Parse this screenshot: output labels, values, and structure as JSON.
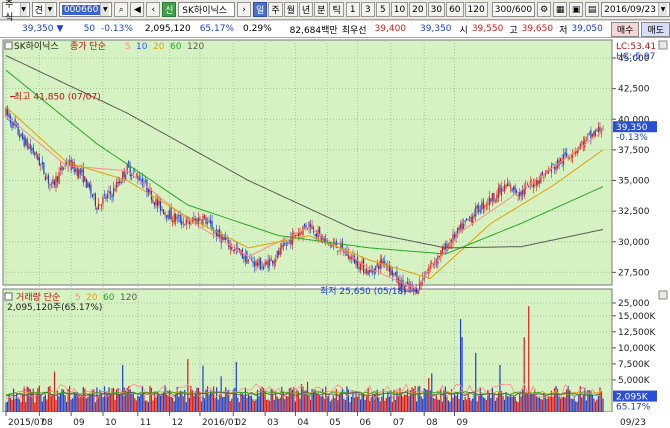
{
  "toolbar": {
    "market": "주식",
    "mode": "견",
    "code": "000660",
    "tag": "신",
    "stock_name": "SK하이닉스",
    "period_buttons": [
      "일",
      "주",
      "월",
      "년",
      "분",
      "틱"
    ],
    "active_period": "일",
    "interval_buttons": [
      "1",
      "3",
      "5",
      "10",
      "20",
      "30",
      "60",
      "120"
    ],
    "count": "300",
    "count_max": "/600",
    "date": "2016/09/23"
  },
  "quote": {
    "price": "39,350",
    "change": "50",
    "change_pct": "-0.13%",
    "volume": "2,095,120",
    "volume_ratio": "65.17%",
    "turnover": "0.29%",
    "amount": "82,684백만",
    "prefer_label": "최우선",
    "prefer_price": "39,400",
    "prefer_price2": "39,350",
    "open_label": "시",
    "open": "39,550",
    "high_label": "고",
    "high": "39,650",
    "low_label": "저",
    "low": "39,050",
    "buy_label": "매수",
    "sell_label": "매도"
  },
  "price_panel": {
    "stock_label": "SK하이닉스",
    "legend_prefix": "종가 단순",
    "ma_periods": [
      "5",
      "10",
      "20",
      "60",
      "120"
    ],
    "lc_label": "LC:53.41",
    "hc_label": "HC:-5.97",
    "max_annotation": "최고 41,850 (07/07)",
    "min_annotation": "최저 25,650 (05/18)",
    "current_tag": "39,350",
    "current_tag_pct": "-0.13%",
    "y_ticks": [
      "45,000",
      "42,500",
      "40,000",
      "37,500",
      "35,000",
      "32,500",
      "30,000",
      "27,500",
      "25,000"
    ]
  },
  "volume_panel": {
    "legend_prefix": "거래량 단순",
    "ma_periods": [
      "5",
      "20",
      "60",
      "120"
    ],
    "volume_text": "2,095,120주(65.17%)",
    "current_tag": "2,095K",
    "current_tag_pct": "65.17%",
    "y_ticks": [
      "15,000K",
      "12,500K",
      "10,000K",
      "7,500K",
      "5,000K"
    ]
  },
  "x_axis": {
    "ticks": [
      "2015/07",
      "08",
      "09",
      "10",
      "11",
      "12",
      "2016/01",
      "02",
      "03",
      "04",
      "05",
      "06",
      "07",
      "08",
      "09",
      "09/23"
    ]
  },
  "colors": {
    "chart_bg": "#d7f2c2",
    "up": "#e01818",
    "down": "#1f3fd0",
    "ma5": "#ff8a8a",
    "ma10": "#3355ff",
    "ma20": "#e0a000",
    "ma60": "#27a927",
    "ma120": "#5a5a5a"
  },
  "chart_data": [
    {
      "type": "candlestick",
      "title": "SK하이닉스",
      "x_range": [
        "2015/07",
        "2016/09/23"
      ],
      "ylim": [
        25000,
        45000
      ],
      "series": [
        {
          "name": "종가",
          "points": [
            [
              0,
              40500
            ],
            [
              10,
              38500
            ],
            [
              20,
              37000
            ],
            [
              30,
              34500
            ],
            [
              40,
              36500
            ],
            [
              50,
              35500
            ],
            [
              60,
              33000
            ],
            [
              70,
              34000
            ],
            [
              80,
              36000
            ],
            [
              90,
              35000
            ],
            [
              100,
              33000
            ],
            [
              110,
              32000
            ],
            [
              120,
              31500
            ],
            [
              130,
              32000
            ],
            [
              140,
              30500
            ],
            [
              150,
              29500
            ],
            [
              160,
              28500
            ],
            [
              170,
              28000
            ],
            [
              180,
              29000
            ],
            [
              190,
              30500
            ],
            [
              200,
              31500
            ],
            [
              210,
              30000
            ],
            [
              220,
              29500
            ],
            [
              230,
              28500
            ],
            [
              240,
              27500
            ],
            [
              250,
              28500
            ],
            [
              260,
              26500
            ],
            [
              270,
              26000
            ],
            [
              280,
              28000
            ],
            [
              290,
              29500
            ],
            [
              300,
              31000
            ],
            [
              310,
              32500
            ],
            [
              320,
              33500
            ],
            [
              330,
              34500
            ],
            [
              340,
              34000
            ],
            [
              350,
              35000
            ],
            [
              360,
              36000
            ],
            [
              370,
              37000
            ],
            [
              380,
              38000
            ],
            [
              390,
              39000
            ],
            [
              394,
              39350
            ]
          ]
        },
        {
          "name": "5",
          "points": [
            [
              0,
              40300
            ],
            [
              40,
              36200
            ],
            [
              80,
              35800
            ],
            [
              120,
              31800
            ],
            [
              160,
              28800
            ],
            [
              200,
              31200
            ],
            [
              240,
              27800
            ],
            [
              270,
              26200
            ],
            [
              300,
              30800
            ],
            [
              340,
              34200
            ],
            [
              394,
              39000
            ]
          ]
        },
        {
          "name": "20",
          "points": [
            [
              0,
              41000
            ],
            [
              40,
              36500
            ],
            [
              80,
              35000
            ],
            [
              120,
              32000
            ],
            [
              160,
              29500
            ],
            [
              200,
              30500
            ],
            [
              240,
              28500
            ],
            [
              280,
              27000
            ],
            [
              320,
              31500
            ],
            [
              360,
              34500
            ],
            [
              394,
              37500
            ]
          ]
        },
        {
          "name": "60",
          "points": [
            [
              0,
              44000
            ],
            [
              60,
              38000
            ],
            [
              120,
              33000
            ],
            [
              180,
              30500
            ],
            [
              240,
              29500
            ],
            [
              290,
              29000
            ],
            [
              340,
              31500
            ],
            [
              394,
              34500
            ]
          ]
        },
        {
          "name": "120",
          "points": [
            [
              0,
              45200
            ],
            [
              80,
              40500
            ],
            [
              160,
              35000
            ],
            [
              230,
              31000
            ],
            [
              290,
              29500
            ],
            [
              340,
              29600
            ],
            [
              394,
              31000
            ]
          ]
        }
      ]
    },
    {
      "type": "bar",
      "title": "거래량",
      "ylim": [
        0,
        17000
      ],
      "series": [
        {
          "name": "거래량",
          "points": [
            [
              0,
              2600
            ],
            [
              20,
              4800
            ],
            [
              40,
              9500
            ],
            [
              60,
              7000
            ],
            [
              85,
              8000
            ],
            [
              100,
              5500
            ],
            [
              125,
              10500
            ],
            [
              150,
              8500
            ],
            [
              175,
              4000
            ],
            [
              210,
              6000
            ],
            [
              240,
              9000
            ],
            [
              270,
              3500
            ],
            [
              300,
              14500
            ],
            [
              330,
              10000
            ],
            [
              345,
              16500
            ],
            [
              360,
              5500
            ],
            [
              380,
              4500
            ],
            [
              394,
              2095
            ]
          ]
        }
      ]
    }
  ]
}
